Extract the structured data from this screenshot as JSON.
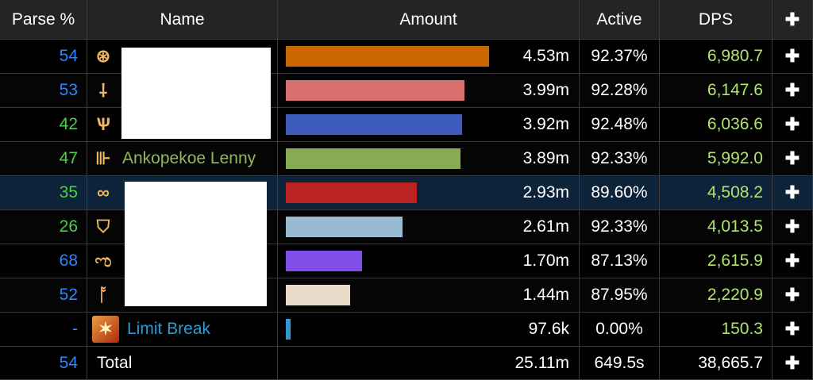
{
  "header": {
    "parse": "Parse %",
    "name": "Name",
    "amount": "Amount",
    "active": "Active",
    "dps": "DPS",
    "plus": "✚"
  },
  "rows": [
    {
      "parse": "54",
      "parse_color": "blue",
      "name": "",
      "icon": "sword-sigil-icon",
      "bar_color": "#cc6600",
      "bar_fraction": 0.693,
      "amount": "4.53m",
      "active": "92.37%",
      "dps": "6,980.7"
    },
    {
      "parse": "53",
      "parse_color": "blue",
      "name": "",
      "icon": "rapier-icon",
      "bar_color": "#d87070",
      "bar_fraction": 0.609,
      "amount": "3.99m",
      "active": "92.28%",
      "dps": "6,147.6"
    },
    {
      "parse": "42",
      "parse_color": "green",
      "name": "",
      "icon": "lance-icon",
      "bar_color": "#3d5bbb",
      "bar_fraction": 0.599,
      "amount": "3.92m",
      "active": "92.48%",
      "dps": "6,036.6"
    },
    {
      "parse": "47",
      "parse_color": "green",
      "name": "Ankopekoe Lenny",
      "name_color": "#8fba5a",
      "icon": "bow-icon",
      "bar_color": "#88aa55",
      "bar_fraction": 0.594,
      "amount": "3.89m",
      "active": "92.33%",
      "dps": "5,992.0"
    },
    {
      "parse": "35",
      "parse_color": "green",
      "name": "",
      "icon": "infinity-icon",
      "bar_color": "#bb2222",
      "bar_fraction": 0.447,
      "amount": "2.93m",
      "active": "89.60%",
      "dps": "4,508.2",
      "highlight": true
    },
    {
      "parse": "26",
      "parse_color": "green",
      "name": "",
      "icon": "shield-icon",
      "bar_color": "#99bbd1",
      "bar_fraction": 0.398,
      "amount": "2.61m",
      "active": "92.33%",
      "dps": "4,013.5"
    },
    {
      "parse": "68",
      "parse_color": "blue",
      "name": "",
      "icon": "knot-icon",
      "bar_color": "#7f4ee8",
      "bar_fraction": 0.259,
      "amount": "1.70m",
      "active": "87.13%",
      "dps": "2,615.9"
    },
    {
      "parse": "52",
      "parse_color": "blue",
      "name": "",
      "icon": "staff-icon",
      "bar_color": "#e8dac8",
      "bar_fraction": 0.22,
      "amount": "1.44m",
      "active": "87.95%",
      "dps": "2,220.9"
    },
    {
      "parse": "-",
      "parse_color": "blue",
      "name": "Limit Break",
      "name_color": "#2f9ad0",
      "icon": "limit-break-icon",
      "bar_color": "#2f9ad0",
      "bar_fraction": 0.015,
      "amount": "97.6k",
      "active": "0.00%",
      "dps": "150.3"
    }
  ],
  "total": {
    "parse": "54",
    "name": "Total",
    "amount": "25.11m",
    "active": "649.5s",
    "dps": "38,665.7"
  }
}
